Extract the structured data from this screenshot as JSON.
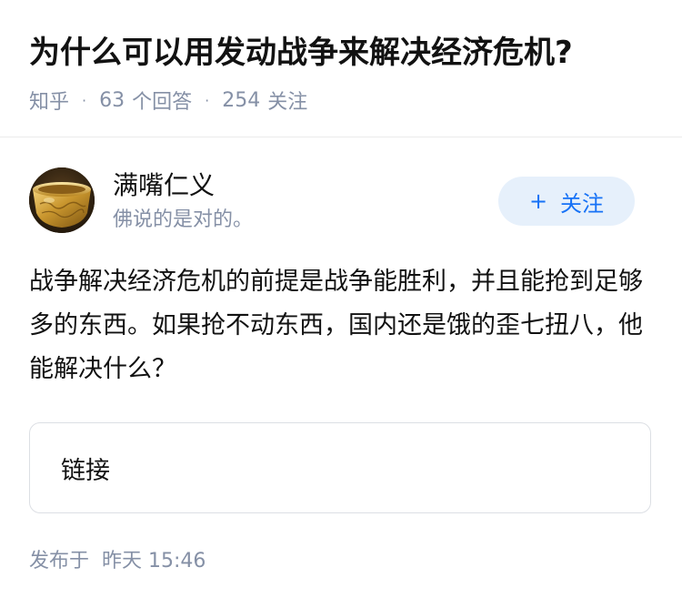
{
  "question": {
    "title": "为什么可以用发动战争来解决经济危机?",
    "source": "知乎",
    "answer_count": "63",
    "answer_count_label": "个回答",
    "follower_count": "254",
    "follower_label": "关注"
  },
  "answer": {
    "author": {
      "name": "满嘴仁义",
      "bio": "佛说的是对的。",
      "avatar_icon": "golden-bowl-avatar"
    },
    "follow_button": {
      "icon": "+",
      "label": "关注"
    },
    "content": "战争解决经济危机的前提是战争能胜利，并且能抢到足够多的东西。如果抢不动东西，国内还是饿的歪七扭八，他能解决什么？",
    "link_card_label": "链接",
    "published_prefix": "发布于",
    "published_time": "昨天 15:46"
  },
  "colors": {
    "title": "#121212",
    "secondary": "#8590a6",
    "accent": "#1772f6",
    "follow_bg": "#e6f0fb",
    "divider": "#ebebeb"
  }
}
